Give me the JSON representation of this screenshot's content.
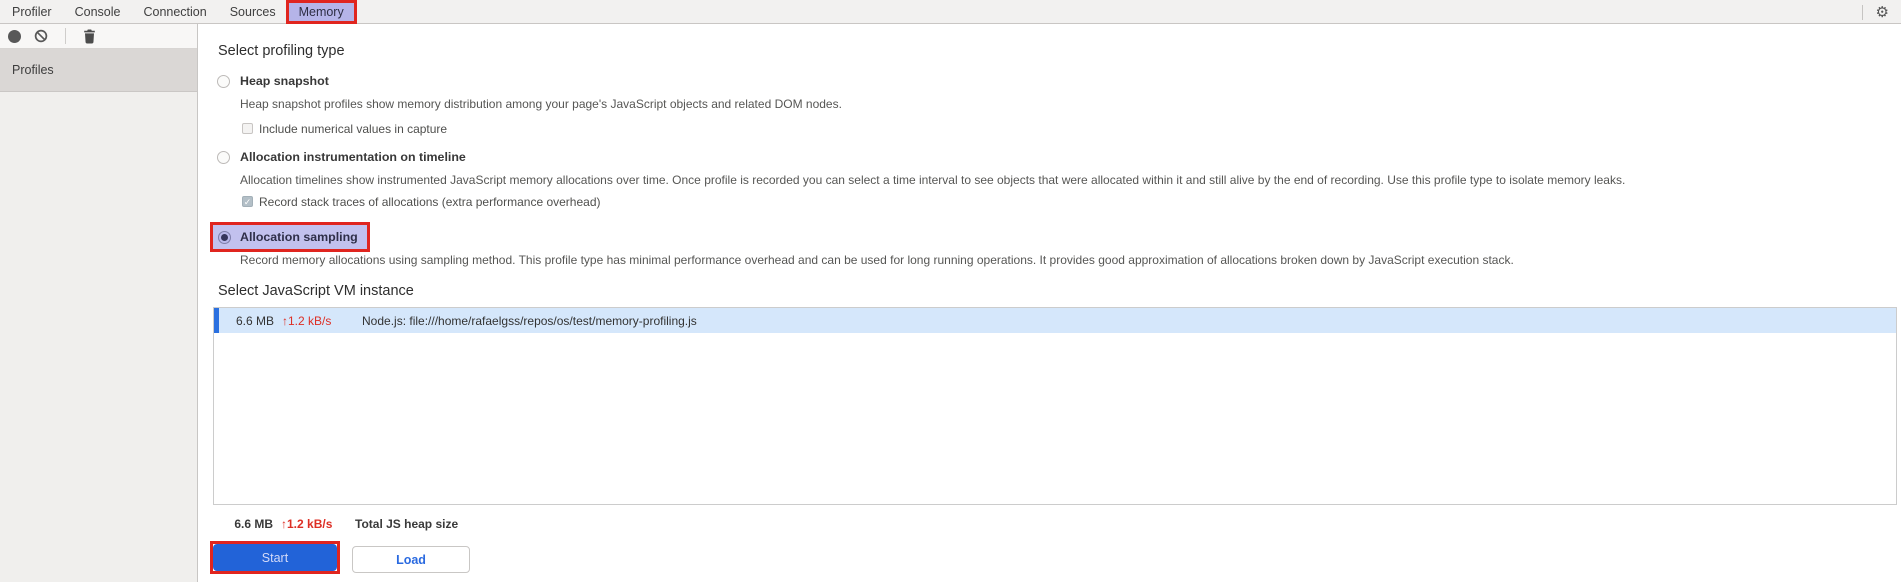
{
  "tabbar": {
    "tabs": [
      {
        "label": "Profiler",
        "active": false
      },
      {
        "label": "Console",
        "active": false
      },
      {
        "label": "Connection",
        "active": false
      },
      {
        "label": "Sources",
        "active": false
      },
      {
        "label": "Memory",
        "active": true,
        "highlighted": true
      }
    ],
    "settings_icon": "gear",
    "settings_glyph": "⚙"
  },
  "toolbar": {
    "icons": [
      {
        "name": "record",
        "shape": "filled-circle"
      },
      {
        "name": "clear-all",
        "shape": "circle-slash"
      },
      {
        "name": "delete-profile",
        "shape": "trash"
      }
    ]
  },
  "sidebar": {
    "header": "Profiles"
  },
  "profiling": {
    "heading": "Select profiling type",
    "options": [
      {
        "label": "Heap snapshot",
        "selected": false,
        "description": "Heap snapshot profiles show memory distribution among your page's JavaScript objects and related DOM nodes.",
        "checkbox": {
          "label": "Include numerical values in capture",
          "checked": false
        }
      },
      {
        "label": "Allocation instrumentation on timeline",
        "selected": false,
        "description": "Allocation timelines show instrumented JavaScript memory allocations over time. Once profile is recorded you can select a time interval to see objects that were allocated within it and still alive by the end of recording. Use this profile type to isolate memory leaks.",
        "checkbox": {
          "label": "Record stack traces of allocations (extra performance overhead)",
          "checked": true,
          "disabled": true
        }
      },
      {
        "label": "Allocation sampling",
        "selected": true,
        "highlighted": true,
        "description": "Record memory allocations using sampling method. This profile type has minimal performance overhead and can be used for long running operations. It provides good approximation of allocations broken down by JavaScript execution stack."
      }
    ]
  },
  "vm": {
    "heading": "Select JavaScript VM instance",
    "instances": [
      {
        "size": "6.6 MB",
        "rate": "↑1.2 kB/s",
        "name": "Node.js: file:///home/rafaelgss/repos/os/test/memory-profiling.js",
        "selected": true
      }
    ],
    "total": {
      "size": "6.6 MB",
      "rate": "↑1.2 kB/s",
      "label": "Total JS heap size"
    }
  },
  "actions": {
    "start": "Start",
    "load": "Load"
  },
  "colors": {
    "highlight_red": "#e0251f",
    "tab_lavender": "#b5b4e8",
    "sampling_lavender": "#c2c1ee",
    "row_selection_bg": "#d5e7fb",
    "row_selection_bar": "#2a70e0",
    "rate_red": "#dd2f25",
    "start_button_blue": "#2263d8",
    "load_text_blue": "#2a6ae0"
  }
}
